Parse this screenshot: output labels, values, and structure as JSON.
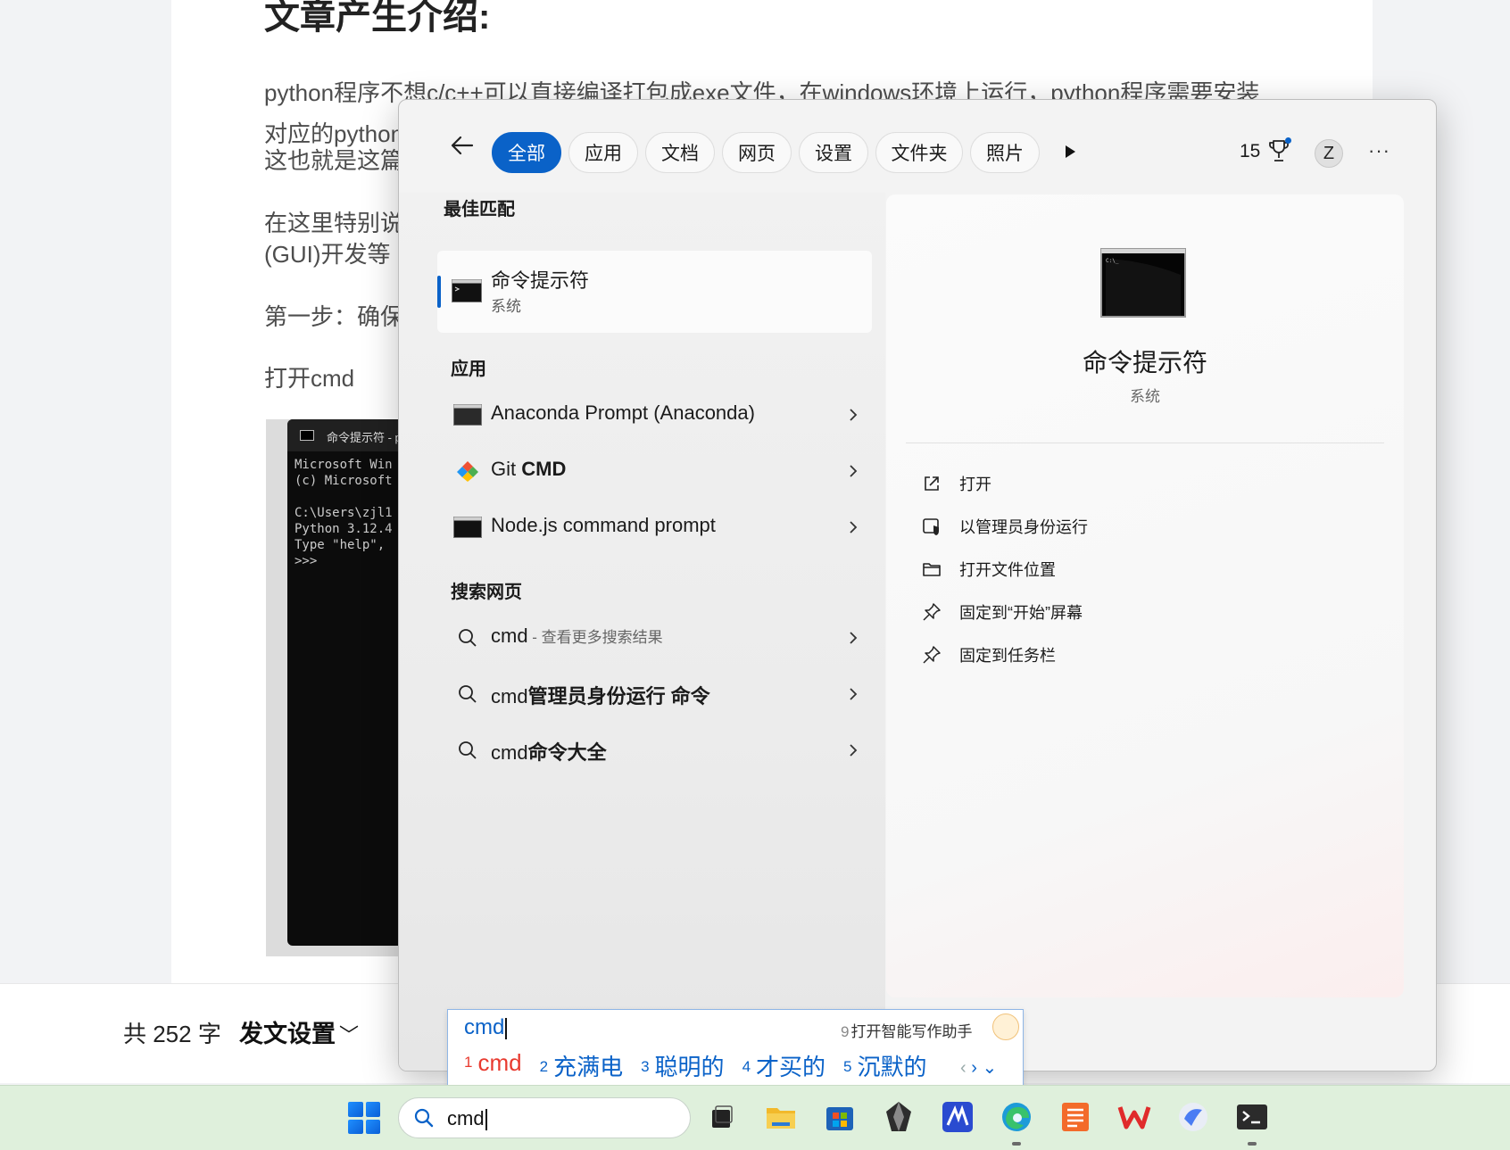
{
  "article": {
    "title": "文章产生介绍:",
    "paragraphs": [
      "python程序不想c/c++可以直接编译打包成exe文件，在windows环境上运行，python程序需要安装",
      "对应的python",
      "这也就是这篇",
      "在这里特别说",
      "(GUI)开发等",
      "第一步：确保",
      "打开cmd"
    ],
    "cmd_window_title": "命令提示符 - py",
    "cmd_window_lines": "Microsoft Win\n(c) Microsoft\n\nC:\\Users\\zjl1\nPython 3.12.4\nType \"help\",\n>>>"
  },
  "editor_bar": {
    "word_count": "共 252 字",
    "post_settings": "发文设置"
  },
  "search": {
    "filters": [
      "全部",
      "应用",
      "文档",
      "网页",
      "设置",
      "文件夹",
      "照片"
    ],
    "active_filter": "全部",
    "points": "15",
    "avatar_letter": "Z",
    "more": "···",
    "best_match_header": "最佳匹配",
    "best_match": {
      "title": "命令提示符",
      "subtitle": "系统"
    },
    "apps_header": "应用",
    "apps": [
      {
        "label": "Anaconda Prompt (Anaconda)",
        "icon": "console-icon"
      },
      {
        "label_prefix": "Git ",
        "label_bold": "CMD",
        "icon": "git-icon"
      },
      {
        "label": "Node.js command prompt",
        "icon": "console-icon"
      }
    ],
    "web_header": "搜索网页",
    "web": [
      {
        "label": "cmd",
        "hint": " - 查看更多搜索结果"
      },
      {
        "label": "cmd",
        "bold": "管理员身份运行 命令"
      },
      {
        "label": "cmd",
        "bold": "命令大全"
      }
    ],
    "detail": {
      "title": "命令提示符",
      "subtitle": "系统",
      "actions": [
        {
          "label": "打开",
          "icon": "open-external-icon"
        },
        {
          "label": "以管理员身份运行",
          "icon": "shield-icon"
        },
        {
          "label": "打开文件位置",
          "icon": "folder-icon"
        },
        {
          "label": "固定到“开始”屏幕",
          "icon": "pin-icon"
        },
        {
          "label": "固定到任务栏",
          "icon": "pin-icon"
        }
      ]
    }
  },
  "ime": {
    "composition": "cmd",
    "assistant_num": "9",
    "assistant_label": "打开智能写作助手",
    "candidates": [
      {
        "n": "1",
        "text": "cmd"
      },
      {
        "n": "2",
        "text": "充满电"
      },
      {
        "n": "3",
        "text": "聪明的"
      },
      {
        "n": "4",
        "text": "才买的"
      },
      {
        "n": "5",
        "text": "沉默的"
      }
    ]
  },
  "taskbar": {
    "search_text": "cmd",
    "apps": [
      "task-view",
      "file-explorer",
      "microsoft-store",
      "obsidian",
      "vscode-like",
      "edge",
      "docs",
      "wps",
      "feishu",
      "terminal"
    ]
  },
  "colors": {
    "accent": "#0a62c8",
    "candidate_first": "#e83a2f",
    "taskbar": "#dff0dc"
  }
}
